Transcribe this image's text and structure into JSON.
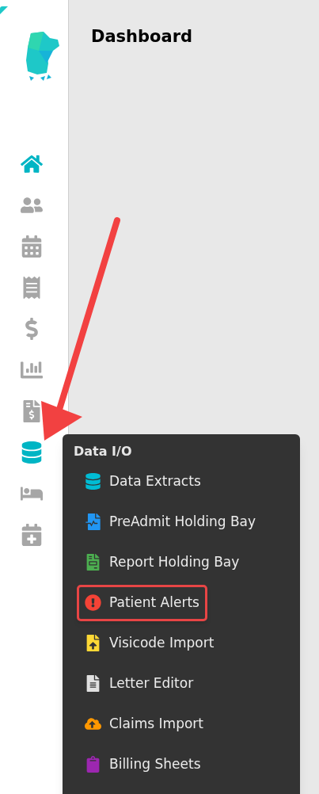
{
  "page": {
    "title": "Dashboard"
  },
  "nav": [
    {
      "kind": "home",
      "highlighted": true
    },
    {
      "kind": "users",
      "highlighted": false
    },
    {
      "kind": "calendar",
      "highlighted": false
    },
    {
      "kind": "receipt",
      "highlighted": false
    },
    {
      "kind": "dollar",
      "highlighted": false
    },
    {
      "kind": "chart",
      "highlighted": false
    },
    {
      "kind": "invoice",
      "highlighted": false
    },
    {
      "kind": "database",
      "highlighted": true
    },
    {
      "kind": "bed",
      "highlighted": false
    },
    {
      "kind": "schedule",
      "highlighted": false
    }
  ],
  "menu": {
    "title": "Data I/O",
    "items": [
      {
        "label": "Data Extracts",
        "kind": "database",
        "color": "#00bcd4",
        "highlighted": false
      },
      {
        "label": "PreAdmit Holding Bay",
        "kind": "medical",
        "color": "#2196f3",
        "highlighted": false
      },
      {
        "label": "Report Holding Bay",
        "kind": "report",
        "color": "#4caf50",
        "highlighted": false
      },
      {
        "label": "Patient Alerts",
        "kind": "alert",
        "color": "#f44336",
        "highlighted": true
      },
      {
        "label": "Visicode Import",
        "kind": "upload",
        "color": "#fdd835",
        "highlighted": false
      },
      {
        "label": "Letter Editor",
        "kind": "document",
        "color": "#e0e0e0",
        "highlighted": false
      },
      {
        "label": "Claims Import",
        "kind": "cloud",
        "color": "#ff9800",
        "highlighted": false
      },
      {
        "label": "Billing Sheets",
        "kind": "clipboard",
        "color": "#9c27b0",
        "highlighted": false
      }
    ]
  }
}
